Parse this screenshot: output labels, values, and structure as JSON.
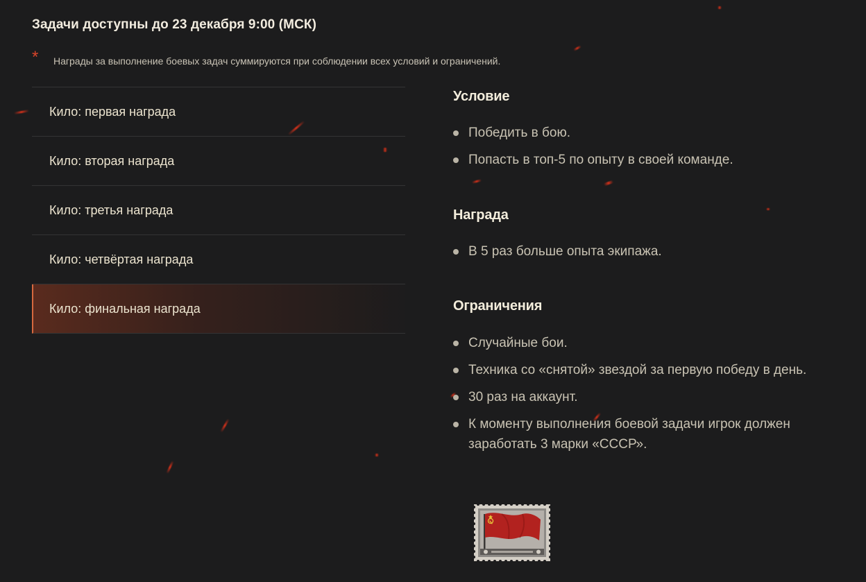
{
  "header": {
    "title": "Задачи доступны до 23 декабря 9:00 (МСК)",
    "note_star": "*",
    "note": "Награды за выполнение боевых задач суммируются при соблюдении всех условий и ограничений."
  },
  "tasks": [
    {
      "label": "Кило: первая награда",
      "active": false
    },
    {
      "label": "Кило: вторая награда",
      "active": false
    },
    {
      "label": "Кило: третья награда",
      "active": false
    },
    {
      "label": "Кило: четвёртая награда",
      "active": false
    },
    {
      "label": "Кило: финальная награда",
      "active": true
    }
  ],
  "details": {
    "condition": {
      "title": "Условие",
      "items": [
        "Победить в бою.",
        "Попасть в топ-5 по опыту в своей команде."
      ]
    },
    "reward": {
      "title": "Награда",
      "items": [
        "В 5 раз больше опыта экипажа."
      ]
    },
    "restrictions": {
      "title": "Ограничения",
      "items": [
        "Случайные бои.",
        "Техника со «снятой» звездой за первую победу в день.",
        "30 раз на аккаунт.",
        "К моменту выполнения боевой задачи игрок должен заработать 3 марки «СССР»."
      ]
    }
  },
  "stamp": {
    "icon": "ussr-flag-stamp-icon"
  },
  "colors": {
    "background": "#1c1c1d",
    "accent": "#d7683f",
    "text_primary": "#f2ecdf",
    "text_secondary": "#c9c3b3"
  }
}
